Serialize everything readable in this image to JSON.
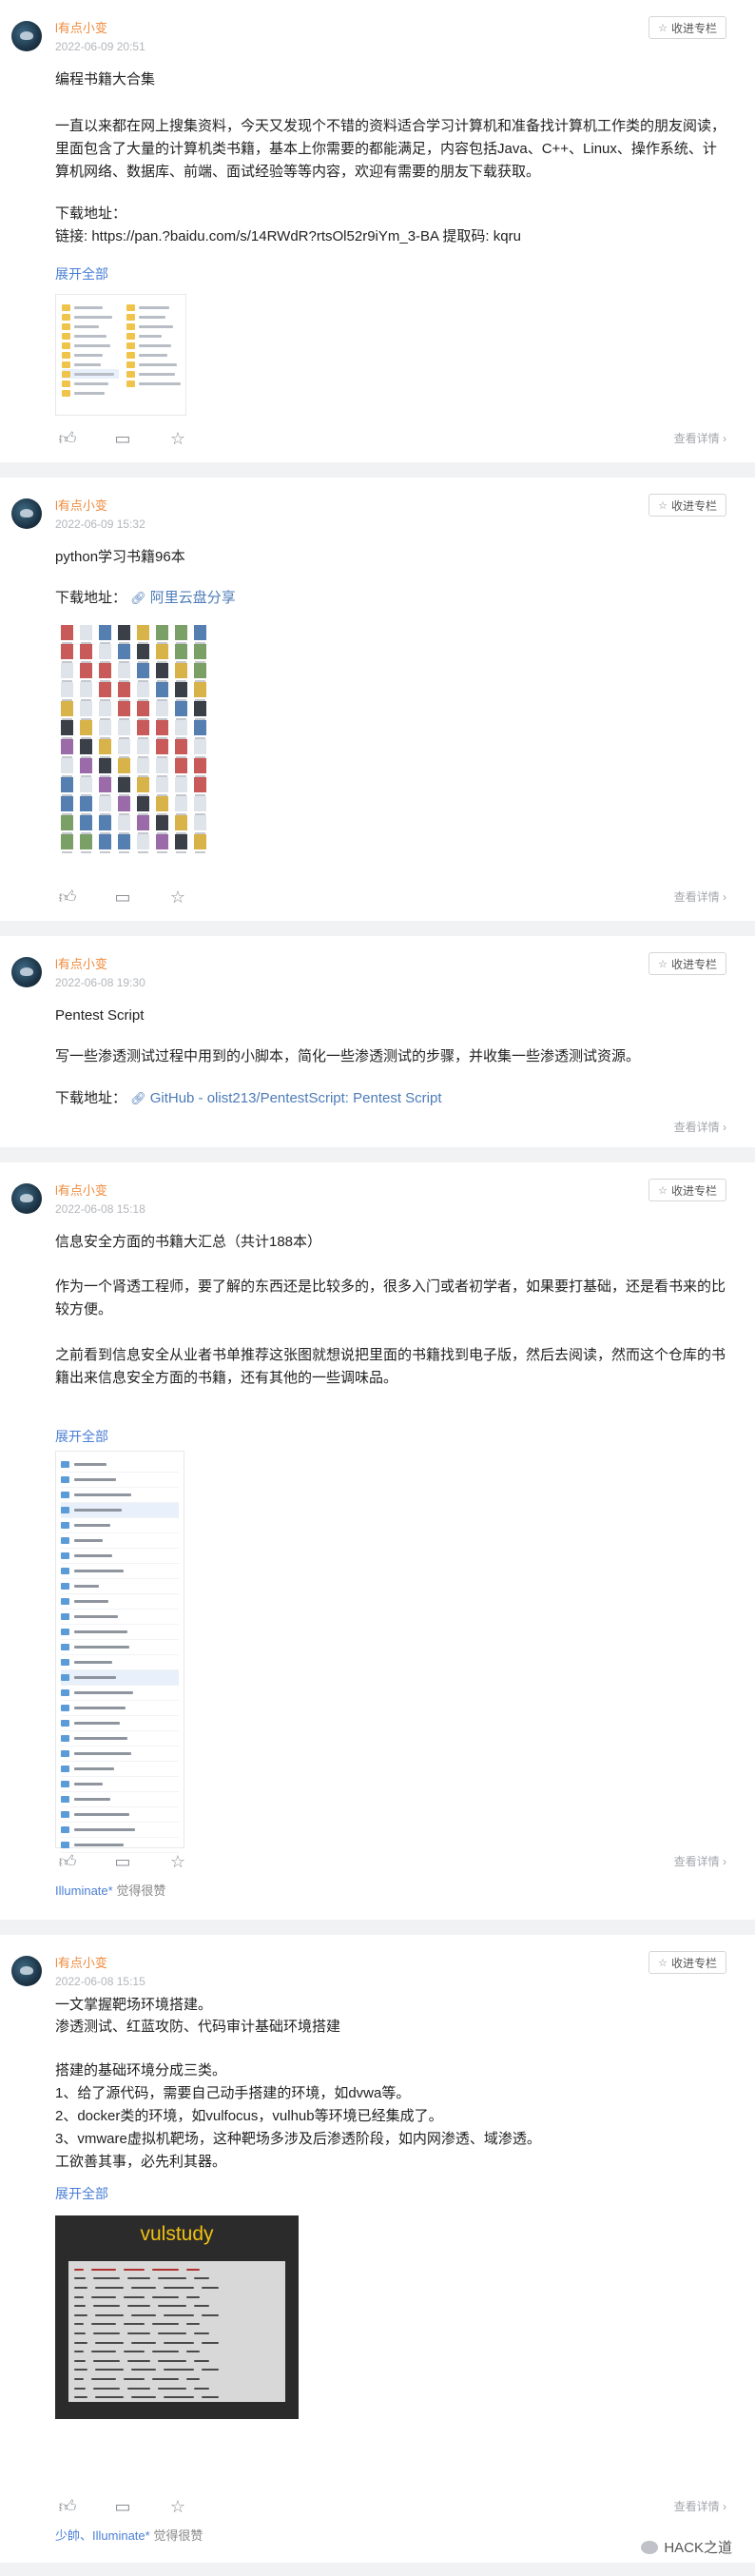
{
  "collect_label": "收进专栏",
  "more_label": "查看详情",
  "expand_label": "展开全部",
  "download_prefix": "下载地址：",
  "posts": [
    {
      "author": "l有点小变",
      "time": "2022-06-09 20:51",
      "title": "编程书籍大合集",
      "paragraphs": [
        "一直以来都在网上搜集资料，今天又发现个不错的资料适合学习计算机和准备找计算机工作类的朋友阅读，里面包含了大量的计算机类书籍，基本上你需要的都能满足，内容包括Java、C++、Linux、操作系统、计算机网络、数据库、前端、面试经验等等内容，欢迎有需要的朋友下载获取。"
      ],
      "download_label": "下载地址：",
      "link_line": "链接: https://pan.?baidu.com/s/14RWdR?rtsOl52r9iYm_3-BA 提取码: kqru"
    },
    {
      "author": "l有点小变",
      "time": "2022-06-09 15:32",
      "title": "python学习书籍96本",
      "link_text": "阿里云盘分享"
    },
    {
      "author": "l有点小变",
      "time": "2022-06-08 19:30",
      "title": "Pentest Script",
      "paragraphs": [
        "写一些渗透测试过程中用到的小脚本，简化一些渗透测试的步骤，并收集一些渗透测试资源。"
      ],
      "link_text": "GitHub - olist213/PentestScript: Pentest Script"
    },
    {
      "author": "l有点小变",
      "time": "2022-06-08 15:18",
      "title": "信息安全方面的书籍大汇总（共计188本）",
      "paragraphs": [
        "作为一个肾透工程师，要了解的东西还是比较多的，很多入门或者初学者，如果要打基础，还是看书来的比较方便。",
        "之前看到信息安全从业者书单推荐这张图就想说把里面的书籍找到电子版，然后去阅读，然而这个仓库的书籍出来信息安全方面的书籍，还有其他的一些调味品。"
      ],
      "likers": "Illuminate*",
      "likers_suffix": "觉得很赞"
    },
    {
      "author": "l有点小变",
      "time": "2022-06-08 15:15",
      "title": "一文掌握靶场环境搭建。",
      "lines": [
        "渗透测试、红蓝攻防、代码审计基础环境搭建",
        "",
        "搭建的基础环境分成三类。",
        "1、给了源代码，需要自己动手搭建的环境，如dvwa等。",
        "2、docker类的环境，如vulfocus，vulhub等环境已经集成了。",
        "3、vmware虚拟机靶场，这种靶场多涉及后渗透阶段，如内网渗透、域渗透。",
        "工欲善其事，必先利其器。"
      ],
      "vul_title": "vulstudy",
      "likers": "少帥、Illuminate*",
      "likers_suffix": "觉得很赞"
    }
  ],
  "watermark": "HACK之道",
  "colors": {
    "author": "#f08a3c",
    "link": "#4a7fd6",
    "bg": "#f1f2f4"
  },
  "icons": [
    "like-icon",
    "comment-icon",
    "favorite-icon",
    "link-icon",
    "star-icon",
    "chevron-right-icon"
  ]
}
